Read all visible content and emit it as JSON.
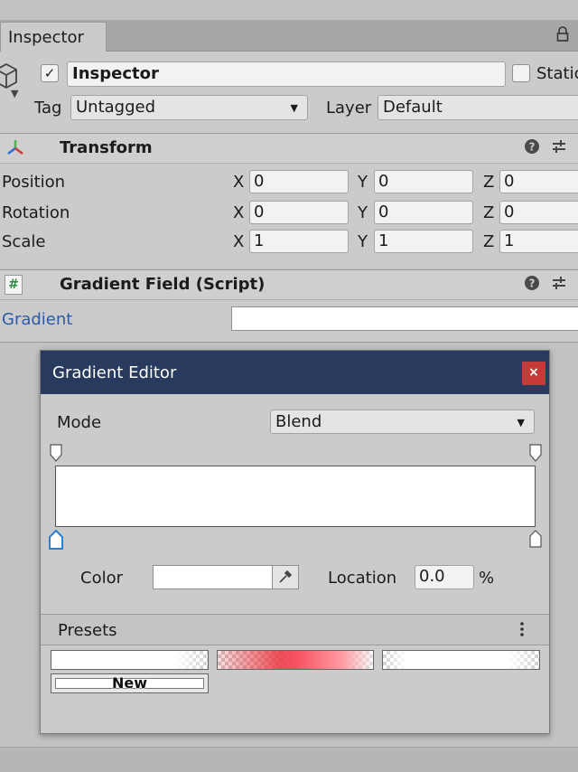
{
  "tab": {
    "title": "Inspector"
  },
  "header": {
    "active_checked": true,
    "name": "Inspector",
    "static_label": "Static",
    "tag_label": "Tag",
    "tag_value": "Untagged",
    "layer_label": "Layer",
    "layer_value": "Default"
  },
  "transform": {
    "title": "Transform",
    "rows": [
      {
        "label": "Position",
        "x": "0",
        "y": "0",
        "z": "0"
      },
      {
        "label": "Rotation",
        "x": "0",
        "y": "0",
        "z": "0"
      },
      {
        "label": "Scale",
        "x": "1",
        "y": "1",
        "z": "1"
      }
    ],
    "axes": {
      "x": "X",
      "y": "Y",
      "z": "Z"
    }
  },
  "script": {
    "icon_text": "#",
    "title": "Gradient Field (Script)",
    "gradient_label": "Gradient"
  },
  "gradient_editor": {
    "title": "Gradient Editor",
    "close_icon": "×",
    "mode_label": "Mode",
    "mode_value": "Blend",
    "color_label": "Color",
    "location_label": "Location",
    "location_value": "0.0",
    "percent": "%",
    "presets_label": "Presets",
    "new_label": "New"
  },
  "colors": {
    "editor_title_bar": "#283a5e",
    "close_button": "#c83a3a",
    "link_blue": "#2a5aa8",
    "selected_marker": "#2a7fd6"
  }
}
